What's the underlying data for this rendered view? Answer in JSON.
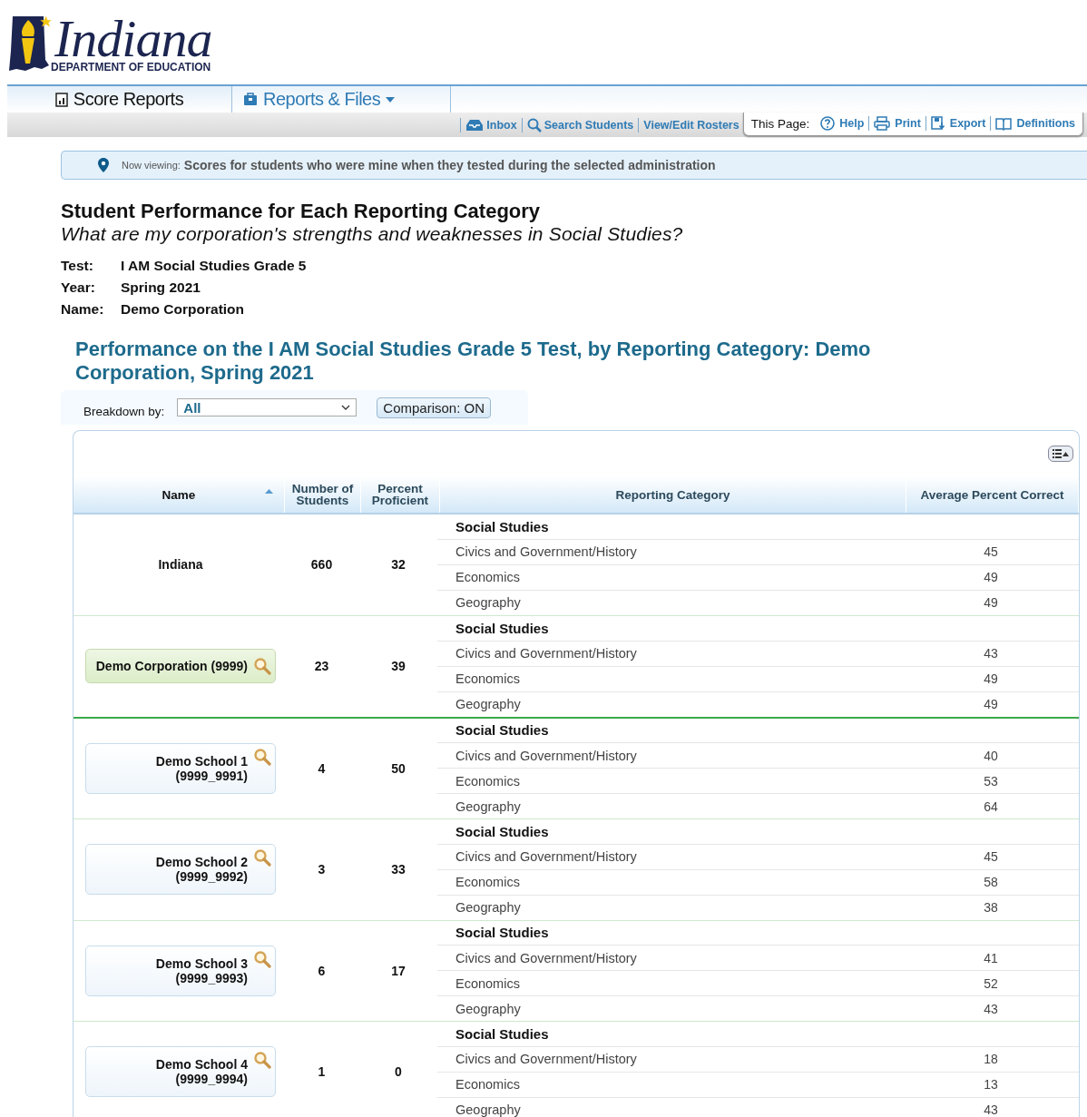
{
  "logo": {
    "title": "Indiana",
    "subtitle": "DEPARTMENT OF EDUCATION"
  },
  "tabs": [
    {
      "label": "Score Reports",
      "selected": true,
      "dropdown": false
    },
    {
      "label": "Reports & Files",
      "selected": false,
      "dropdown": true
    }
  ],
  "toolbar_links": [
    "Inbox",
    "Search Students",
    "View/Edit Rosters"
  ],
  "this_page": {
    "label": "This Page:",
    "links": [
      "Help",
      "Print",
      "Export",
      "Definitions"
    ]
  },
  "banner": {
    "label": "Now viewing:",
    "text": "Scores for students who were mine when they tested during the selected administration"
  },
  "heading": "Student Performance for Each Reporting Category",
  "subheading": "What are my corporation's strengths and weaknesses in Social Studies?",
  "details": [
    {
      "label": "Test:",
      "value": "I AM Social Studies Grade 5"
    },
    {
      "label": "Year:",
      "value": "Spring 2021"
    },
    {
      "label": "Name:",
      "value": "Demo Corporation"
    }
  ],
  "report_title": "Performance on the I AM Social Studies Grade 5 Test, by Reporting Category: Demo Corporation, Spring 2021",
  "breakdown": {
    "label": "Breakdown by:",
    "value": "All"
  },
  "comparison_button": "Comparison: ON",
  "table": {
    "columns": [
      "Name",
      "Number of Students",
      "Percent Proficient",
      "Reporting Category",
      "Average Percent Correct"
    ],
    "groups": [
      {
        "kind": "state",
        "name": "Indiana",
        "selected": false,
        "students": "660",
        "proficient": "32",
        "subject": "Social Studies",
        "categories": [
          {
            "name": "Civics and Government/History",
            "value": "45"
          },
          {
            "name": "Economics",
            "value": "49"
          },
          {
            "name": "Geography",
            "value": "49"
          }
        ]
      },
      {
        "kind": "entity",
        "name": "Demo Corporation (9999)",
        "selected": true,
        "students": "23",
        "proficient": "39",
        "subject": "Social Studies",
        "categories": [
          {
            "name": "Civics and Government/History",
            "value": "43"
          },
          {
            "name": "Economics",
            "value": "49"
          },
          {
            "name": "Geography",
            "value": "49"
          }
        ]
      },
      {
        "kind": "entity",
        "name": "Demo School 1 (9999_9991)",
        "selected": false,
        "students": "4",
        "proficient": "50",
        "subject": "Social Studies",
        "categories": [
          {
            "name": "Civics and Government/History",
            "value": "40"
          },
          {
            "name": "Economics",
            "value": "53"
          },
          {
            "name": "Geography",
            "value": "64"
          }
        ]
      },
      {
        "kind": "entity",
        "name": "Demo School 2 (9999_9992)",
        "selected": false,
        "students": "3",
        "proficient": "33",
        "subject": "Social Studies",
        "categories": [
          {
            "name": "Civics and Government/History",
            "value": "45"
          },
          {
            "name": "Economics",
            "value": "58"
          },
          {
            "name": "Geography",
            "value": "38"
          }
        ]
      },
      {
        "kind": "entity",
        "name": "Demo School 3 (9999_9993)",
        "selected": false,
        "students": "6",
        "proficient": "17",
        "subject": "Social Studies",
        "categories": [
          {
            "name": "Civics and Government/History",
            "value": "41"
          },
          {
            "name": "Economics",
            "value": "52"
          },
          {
            "name": "Geography",
            "value": "43"
          }
        ]
      },
      {
        "kind": "entity",
        "name": "Demo School 4 (9999_9994)",
        "selected": false,
        "students": "1",
        "proficient": "0",
        "subject": "Social Studies",
        "categories": [
          {
            "name": "Civics and Government/History",
            "value": "18"
          },
          {
            "name": "Economics",
            "value": "13"
          },
          {
            "name": "Geography",
            "value": "43"
          }
        ]
      }
    ]
  }
}
